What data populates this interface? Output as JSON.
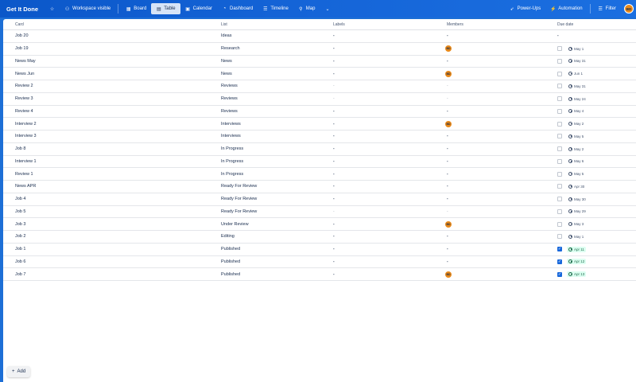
{
  "header": {
    "board_title": "Get It Done",
    "workspace_visibility": "Workspace visible",
    "views": [
      {
        "label": "Board",
        "icon": "board-icon",
        "active": false
      },
      {
        "label": "Table",
        "icon": "table-icon",
        "active": true
      },
      {
        "label": "Calendar",
        "icon": "calendar-icon",
        "active": false
      },
      {
        "label": "Dashboard",
        "icon": "dashboard-icon",
        "active": false
      },
      {
        "label": "Timeline",
        "icon": "timeline-icon",
        "active": false
      },
      {
        "label": "Map",
        "icon": "map-icon",
        "active": false
      }
    ],
    "power_ups": "Power-Ups",
    "automation": "Automation",
    "filter": "Filter",
    "user_initials": "BD"
  },
  "table": {
    "columns": {
      "card": "Card",
      "list": "List",
      "labels": "Labels",
      "members": "Members",
      "due": "Due date"
    },
    "rows": [
      {
        "card": "Job 20",
        "list": "Ideas",
        "labels": "-",
        "member": "-",
        "due": "-",
        "checkbox": false,
        "complete": false
      },
      {
        "card": "Job 19",
        "list": "Research",
        "labels": "-",
        "member": "BD",
        "due": "May 1",
        "checkbox": true,
        "complete": false
      },
      {
        "card": "News May",
        "list": "News",
        "labels": "-",
        "member": "-",
        "due": "May 31",
        "checkbox": true,
        "complete": false
      },
      {
        "card": "News Jun",
        "list": "News",
        "labels": "-",
        "member": "BD",
        "due": "Jun 1",
        "checkbox": true,
        "complete": false
      },
      {
        "card": "Review 2",
        "list": "Reviews",
        "labels": "-",
        "member": "-",
        "due": "May 31",
        "checkbox": true,
        "complete": false,
        "faint": true
      },
      {
        "card": "Review 3",
        "list": "Reviews",
        "labels": "-",
        "member": "-",
        "due": "May 24",
        "checkbox": true,
        "complete": false,
        "faint": true
      },
      {
        "card": "Review 4",
        "list": "Reviews",
        "labels": "-",
        "member": "-",
        "due": "May 4",
        "checkbox": true,
        "complete": false
      },
      {
        "card": "Interview 2",
        "list": "Interviews",
        "labels": "-",
        "member": "BD",
        "due": "May 2",
        "checkbox": true,
        "complete": false
      },
      {
        "card": "Interview 3",
        "list": "Interviews",
        "labels": "-",
        "member": "-",
        "due": "May 5",
        "checkbox": true,
        "complete": false
      },
      {
        "card": "Job 8",
        "list": "In Progress",
        "labels": "-",
        "member": "-",
        "due": "May 2",
        "checkbox": true,
        "complete": false
      },
      {
        "card": "Interview 1",
        "list": "In Progress",
        "labels": "-",
        "member": "-",
        "due": "May 6",
        "checkbox": true,
        "complete": false
      },
      {
        "card": "Review 1",
        "list": "In Progress",
        "labels": "-",
        "member": "-",
        "due": "May 5",
        "checkbox": true,
        "complete": false
      },
      {
        "card": "News APR",
        "list": "Ready For Review",
        "labels": "-",
        "member": "-",
        "due": "Apr 30",
        "checkbox": true,
        "complete": false
      },
      {
        "card": "Job 4",
        "list": "Ready For Review",
        "labels": "-",
        "member": "-",
        "due": "May 30",
        "checkbox": true,
        "complete": false
      },
      {
        "card": "Job 5",
        "list": "Ready For Review",
        "labels": "-",
        "member": "-",
        "due": "May 29",
        "checkbox": true,
        "complete": false,
        "faint": true
      },
      {
        "card": "Job 3",
        "list": "Under Review",
        "labels": "-",
        "member": "BD",
        "due": "May 3",
        "checkbox": true,
        "complete": false
      },
      {
        "card": "Job 2",
        "list": "Editing",
        "labels": "-",
        "member": "-",
        "due": "May 1",
        "checkbox": true,
        "complete": false
      },
      {
        "card": "Job 1",
        "list": "Published",
        "labels": "-",
        "member": "-",
        "due": "Apr 11",
        "checkbox": true,
        "complete": true
      },
      {
        "card": "Job 6",
        "list": "Published",
        "labels": "-",
        "member": "-",
        "due": "Apr 12",
        "checkbox": true,
        "complete": true
      },
      {
        "card": "Job 7",
        "list": "Published",
        "labels": "-",
        "member": "BD",
        "due": "Apr 13",
        "checkbox": true,
        "complete": true
      }
    ]
  },
  "add_button": {
    "label": "Add",
    "icon": "plus-icon"
  },
  "colors": {
    "header_blue": "#0b57c9",
    "avatar_orange": "#e8891a",
    "checked_blue": "#1868db",
    "done_green": "#dcfff1"
  }
}
